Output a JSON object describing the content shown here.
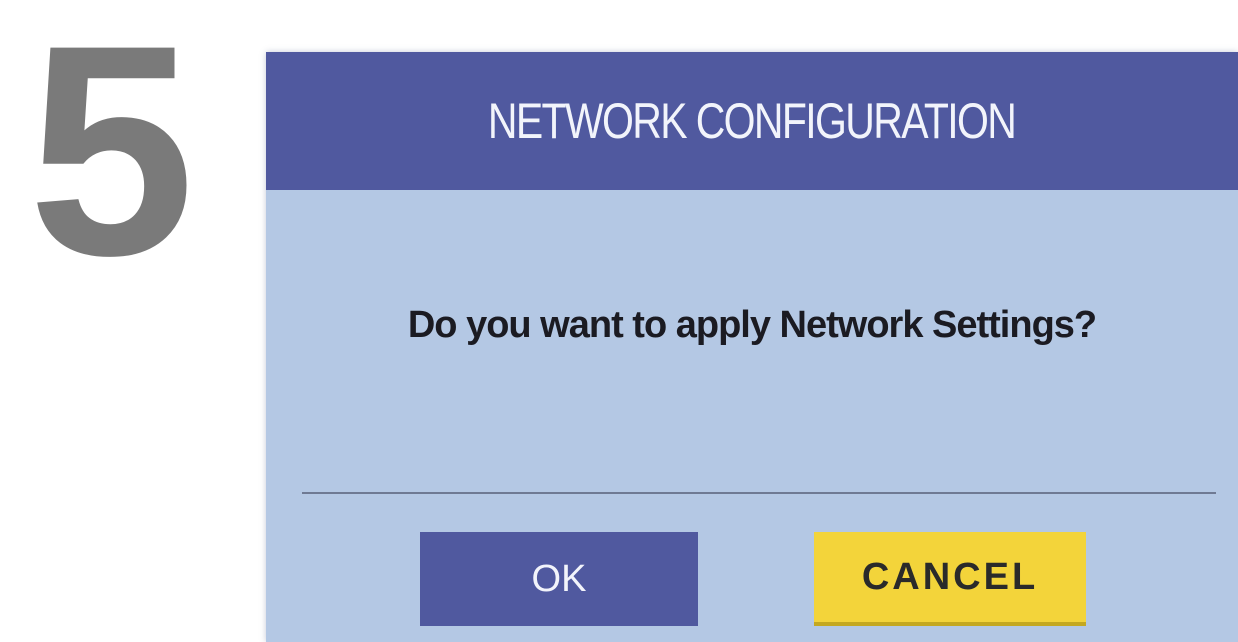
{
  "step": {
    "number": "5"
  },
  "dialog": {
    "title": "NETWORK CONFIGURATION",
    "message": "Do you want to apply Network Settings?",
    "buttons": {
      "ok_label": "OK",
      "cancel_label": "CANCEL"
    }
  },
  "colors": {
    "header_bg": "#50599f",
    "dialog_bg": "#b4c8e4",
    "ok_button_bg": "#50599f",
    "cancel_button_bg": "#f3d43a",
    "step_number": "#7a7a7a"
  }
}
